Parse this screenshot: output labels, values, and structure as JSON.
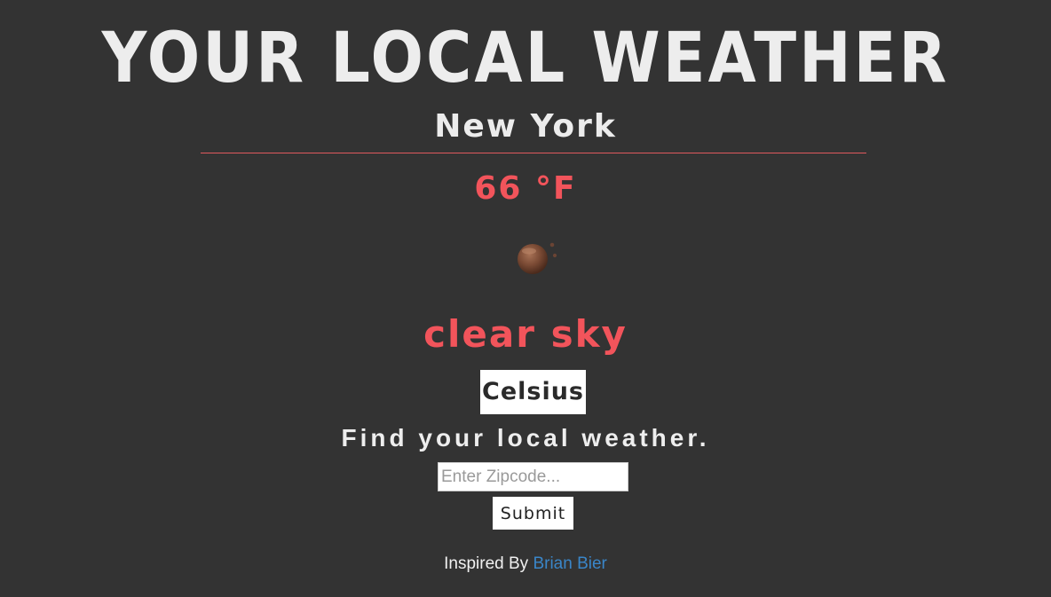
{
  "header": {
    "title": "YOUR LOCAL WEATHER"
  },
  "weather": {
    "city": "New York",
    "temperature": "66 °F",
    "icon": "clear-sky-night-icon",
    "description": "clear sky",
    "unit_toggle_label": "Celsius"
  },
  "search": {
    "prompt": "Find your local weather.",
    "zip_placeholder": "Enter Zipcode...",
    "zip_value": "",
    "submit_label": "Submit"
  },
  "footer": {
    "credit_prefix": "Inspired By",
    "author_link": "Brian Bier"
  },
  "colors": {
    "background": "#333333",
    "accent": "#f2545b",
    "divider": "#e05a5e",
    "link": "#3a86c8"
  }
}
